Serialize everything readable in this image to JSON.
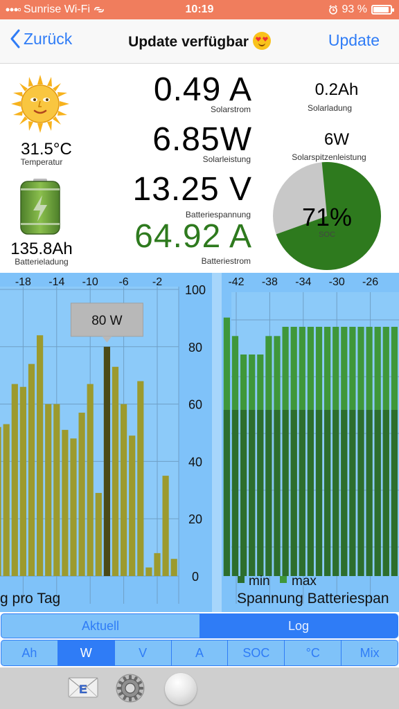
{
  "status_bar": {
    "carrier": "Sunrise Wi-Fi",
    "time": "10:19",
    "battery_percent": "93 %",
    "battery_level": 0.93
  },
  "nav": {
    "back_label": "Zurück",
    "title": "Update verfügbar",
    "update_label": "Update"
  },
  "dashboard": {
    "solarstrom": {
      "value": "0.49 A",
      "label": "Solarstrom"
    },
    "solarleistung": {
      "value": "6.85W",
      "label": "Solarleistung"
    },
    "batteriespannung": {
      "value": "13.25 V",
      "label": "Batteriespannung"
    },
    "batteriestrom": {
      "value": "64.92 A",
      "label": "Batteriestrom"
    },
    "temperatur": {
      "value": "31.5°C",
      "label": "Temperatur"
    },
    "batterieladung": {
      "value": "135.8Ah",
      "label": "Batterieladung"
    },
    "solarladung": {
      "value": "0.2Ah",
      "label": "Solarladung"
    },
    "solarspitzenleistung": {
      "value": "6W",
      "label": "Solarspitzenleistung"
    },
    "soc": {
      "value": "71%",
      "label": "SOC",
      "fraction": 0.71
    }
  },
  "colors": {
    "accent": "#2f7cf6",
    "green_value": "#2e7a1e",
    "chart_bg": "#7fc2f9",
    "bar_olive": "#9c9a2e",
    "bar_selected": "#4b4a17",
    "bar_min": "#2d6e2d",
    "bar_max": "#3f973a",
    "pie_green": "#2e7a1e",
    "pie_grey": "#c8c8c8"
  },
  "chart_data": [
    {
      "type": "bar",
      "title": "",
      "xlabel": "",
      "caption": "g pro Tag",
      "x_ticks": [
        -18,
        -14,
        -10,
        -6,
        -2
      ],
      "y_ticks": [
        0,
        20,
        40,
        60,
        80,
        100
      ],
      "ylim": [
        0,
        100
      ],
      "y_axis_side": "right",
      "grid": true,
      "x": [
        -21,
        -20,
        -19,
        -18,
        -17,
        -16,
        -15,
        -14,
        -13,
        -12,
        -11,
        -10,
        -9,
        -8,
        -7,
        -6,
        -5,
        -4,
        -3,
        -2,
        -1,
        0
      ],
      "values": [
        52,
        53,
        67,
        66,
        74,
        84,
        60,
        60,
        51,
        48,
        57,
        67,
        29,
        80,
        73,
        60,
        49,
        68,
        3,
        8,
        35,
        6
      ],
      "selected_index": 13,
      "tooltip": "80 W"
    },
    {
      "type": "bar",
      "title": "",
      "caption": "Spannung Batteriespan",
      "x_ticks": [
        -42,
        -38,
        -34,
        -30,
        -26
      ],
      "grid": true,
      "legend_position": "bottom-left",
      "legend": [
        "min",
        "max"
      ],
      "x": [
        -44,
        -43,
        -42,
        -41,
        -40,
        -39,
        -38,
        -37,
        -36,
        -35,
        -34,
        -33,
        -32,
        -31,
        -30,
        -29,
        -28,
        -27,
        -26,
        -25,
        -24
      ],
      "series": [
        {
          "name": "min",
          "values": [
            12.8,
            12.8,
            12.8,
            12.8,
            12.8,
            12.8,
            12.8,
            12.8,
            12.8,
            12.8,
            12.8,
            12.8,
            12.8,
            12.8,
            12.8,
            12.8,
            12.8,
            12.8,
            12.8,
            12.8,
            12.8
          ]
        },
        {
          "name": "max",
          "values": [
            13.8,
            13.6,
            13.4,
            13.4,
            13.4,
            13.6,
            13.6,
            13.7,
            13.7,
            13.7,
            13.7,
            13.7,
            13.7,
            13.7,
            13.7,
            13.7,
            13.7,
            13.7,
            13.7,
            13.7,
            13.7
          ]
        }
      ]
    }
  ],
  "segments_mode": [
    {
      "label": "Aktuell"
    },
    {
      "label": "Log"
    }
  ],
  "segments_unit": [
    {
      "label": "Ah"
    },
    {
      "label": "W"
    },
    {
      "label": "V"
    },
    {
      "label": "A"
    },
    {
      "label": "SOC"
    },
    {
      "label": "°C"
    },
    {
      "label": "Mix"
    }
  ],
  "toolbar": {
    "mail_letter": "E"
  }
}
